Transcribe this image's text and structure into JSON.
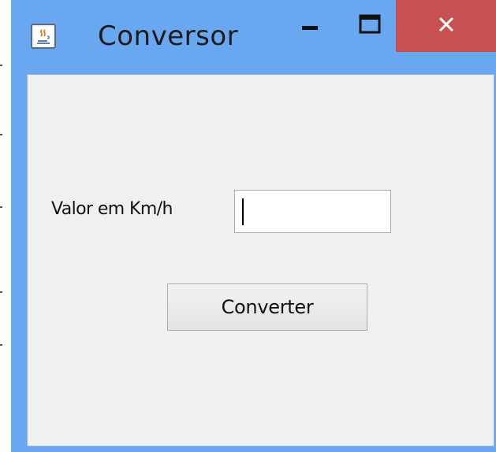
{
  "window": {
    "title": "Conversor",
    "controls": {
      "minimize": "minimize-icon",
      "maximize": "maximize-icon",
      "close": "close-icon"
    },
    "accent_color": "#69a7f0",
    "close_color": "#c75050"
  },
  "form": {
    "label": "Valor em Km/h",
    "input_value": "",
    "button_label": "Converter"
  }
}
